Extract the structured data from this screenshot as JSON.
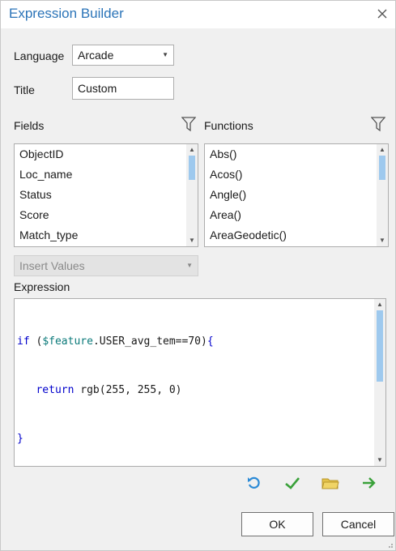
{
  "dialog": {
    "title": "Expression Builder"
  },
  "language": {
    "label": "Language",
    "value": "Arcade"
  },
  "title_field": {
    "label": "Title",
    "value": "Custom"
  },
  "fields": {
    "label": "Fields",
    "items": [
      "ObjectID",
      "Loc_name",
      "Status",
      "Score",
      "Match_type"
    ]
  },
  "functions": {
    "label": "Functions",
    "items": [
      "Abs()",
      "Acos()",
      "Angle()",
      "Area()",
      "AreaGeodetic()"
    ]
  },
  "insert_values": {
    "label": "Insert Values"
  },
  "expression": {
    "label": "Expression",
    "lines": [
      "if ($feature.USER_avg_tem==70){",
      "   return rgb(255, 255, 0)",
      "}"
    ]
  },
  "buttons": {
    "ok": "OK",
    "cancel": "Cancel"
  },
  "icons": {
    "close": "close-icon",
    "undo": "undo-icon",
    "verify": "checkmark-icon",
    "open": "folder-icon",
    "run": "arrow-right-icon",
    "filter": "filter-icon"
  },
  "colors": {
    "title": "#2b74b8",
    "undo": "#2b8ad6",
    "verify": "#3aa13a",
    "folder": "#d6b43a",
    "run": "#3aa13a",
    "scroll_thumb": "#9ec9ee"
  }
}
